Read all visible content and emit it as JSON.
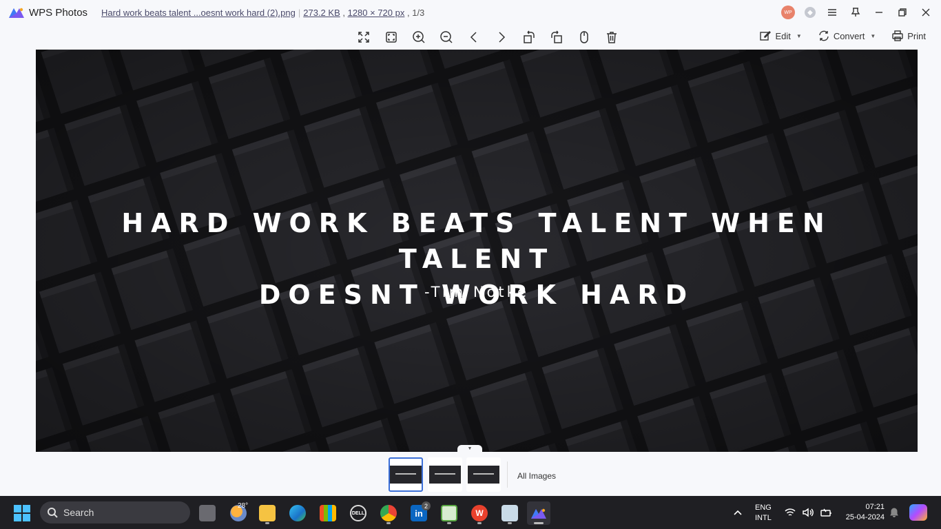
{
  "titlebar": {
    "app_name": "WPS Photos",
    "file_name": "Hard work beats talent ...oesnt work hard (2).png",
    "file_size": "273.2 KB",
    "dimensions": "1280 × 720 px",
    "position": "1/3",
    "avatar_text": "WP"
  },
  "toolbar": {
    "tools": [
      "fit-screen",
      "actual-size",
      "zoom-in",
      "zoom-out",
      "previous",
      "next",
      "rotate-left",
      "rotate-right",
      "mouse-mode",
      "delete"
    ],
    "edit_label": "Edit",
    "convert_label": "Convert",
    "print_label": "Print"
  },
  "image": {
    "quote_line1": "HARD WORK BEATS TALENT WHEN TALENT",
    "quote_line2": "DOESNT WORK HARD",
    "author": "-Tim Notke"
  },
  "strip": {
    "thumbnails": 3,
    "active_index": 0,
    "all_images_label": "All Images"
  },
  "taskbar": {
    "search_placeholder": "Search",
    "weather_temp": "28°",
    "linkedin_badge": "2",
    "language_line1": "ENG",
    "language_line2": "INTL",
    "time": "07:21",
    "date": "25-04-2024"
  }
}
